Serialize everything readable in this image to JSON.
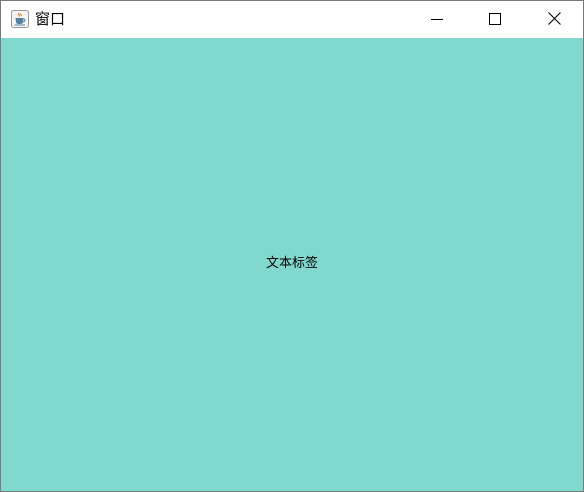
{
  "window": {
    "title": "窗口",
    "app_icon": "java-coffee-cup-icon",
    "controls": {
      "minimize_icon": "minimize-icon",
      "maximize_icon": "maximize-icon",
      "close_icon": "close-icon"
    }
  },
  "content": {
    "background_color": "#81d8cf",
    "label_text": "文本标签"
  }
}
